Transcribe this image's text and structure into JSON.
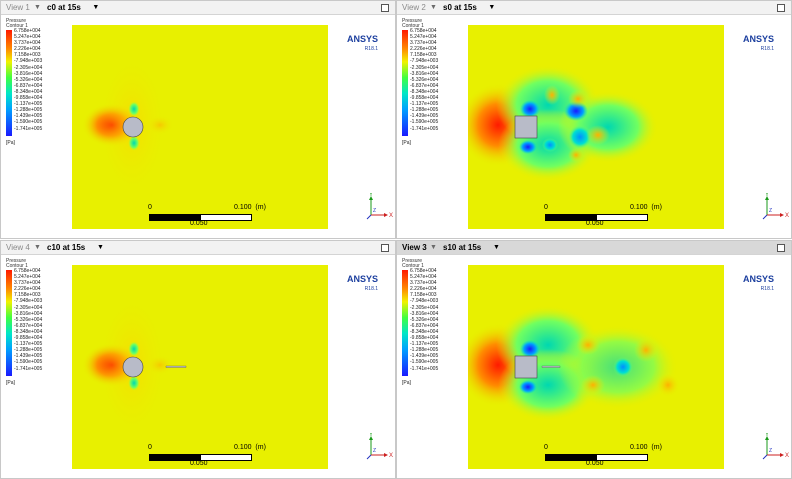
{
  "views": [
    {
      "name": "View 1",
      "title": "c0 at 15s",
      "active": false,
      "shape": "cylinder",
      "wake": false
    },
    {
      "name": "View 2",
      "title": "s0 at 15s",
      "active": false,
      "shape": "square",
      "wake": false
    },
    {
      "name": "View 4",
      "title": "c10 at 15s",
      "active": false,
      "shape": "cylinder",
      "wake": true
    },
    {
      "name": "View 3",
      "title": "s10 at 15s",
      "active": true,
      "shape": "square",
      "wake": true
    }
  ],
  "legend": {
    "title_line1": "Pressure",
    "title_line2": "Contour 1",
    "values": [
      "6.758e+004",
      "5.247e+004",
      "3.737e+004",
      "2.226e+004",
      "7.158e+003",
      "-7.948e+003",
      "-2.305e+004",
      "-3.816e+004",
      "-5.326e+004",
      "-6.837e+004",
      "-8.348e+004",
      "-9.858e+004",
      "-1.137e+005",
      "-1.288e+005",
      "-1.439e+005",
      "-1.590e+005",
      "-1.741e+005"
    ],
    "unit": "[Pa]"
  },
  "logo": {
    "brand": "ANSYS",
    "version": "R18.1"
  },
  "scale": {
    "zero": "0",
    "max": "0.100",
    "unit": "(m)",
    "mid": "0.050"
  },
  "axes": {
    "x": "X",
    "y": "Y",
    "z": "Z"
  },
  "colors": {
    "background_field": "#e8f000",
    "high": "#ff2a00",
    "low": "#1a2cff"
  }
}
